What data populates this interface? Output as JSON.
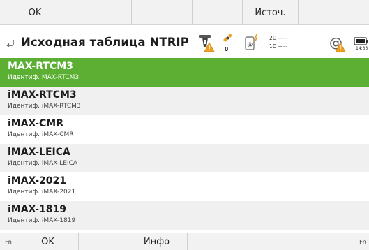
{
  "top_bar": {
    "ok_label": "OK",
    "source_label": "Источ."
  },
  "header": {
    "title": "Исходная таблица NTRIP",
    "satellites_count": "0",
    "dims_2d": "2D -----",
    "dims_1d": "1D -----",
    "time": "14:33"
  },
  "list": {
    "items": [
      {
        "name": "MAX-RTCM3",
        "ident": "Идентиф. MAX-RTCM3",
        "selected": true
      },
      {
        "name": "iMAX-RTCM3",
        "ident": "Идентиф. iMAX-RTCM3",
        "selected": false
      },
      {
        "name": "iMAX-CMR",
        "ident": "Идентиф. iMAX-CMR",
        "selected": false
      },
      {
        "name": "iMAX-LEICA",
        "ident": "Идентиф. iMAX-LEICA",
        "selected": false
      },
      {
        "name": "iMAX-2021",
        "ident": "Идентиф. iMAX-2021",
        "selected": false
      },
      {
        "name": "iMAX-1819",
        "ident": "Идентиф. iMAX-1819",
        "selected": false
      }
    ]
  },
  "bottom_bar": {
    "fn_left": "Fn",
    "ok_label": "OK",
    "info_label": "Инфо",
    "fn_right": "Fn"
  },
  "colors": {
    "selected_row": "#5bb033",
    "warning": "#f0a020"
  },
  "icons": [
    "back-arrow-icon",
    "antenna-warning-icon",
    "satellite-icon",
    "device-battery-icon",
    "at-warning-icon",
    "battery-icon"
  ]
}
